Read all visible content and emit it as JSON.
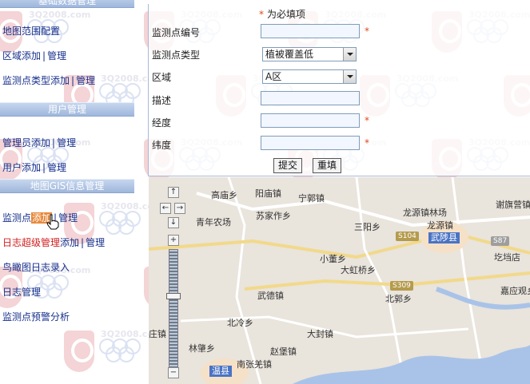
{
  "sidebar": {
    "sections": [
      {
        "header": "基础数据管理",
        "items": [
          {
            "parts": [
              {
                "text": "地图范围配置",
                "style": "navy"
              }
            ]
          },
          {
            "parts": [
              {
                "text": "区域",
                "style": "navy"
              },
              {
                "text": "添加",
                "style": "navy"
              },
              {
                "text": "|",
                "style": "sep"
              },
              {
                "text": "管理",
                "style": "navy"
              }
            ]
          },
          {
            "parts": [
              {
                "text": "监测点类型",
                "style": "navy"
              },
              {
                "text": "添加",
                "style": "navy"
              },
              {
                "text": "|",
                "style": "sep"
              },
              {
                "text": "管理",
                "style": "navy"
              }
            ]
          }
        ]
      },
      {
        "header": "用户管理",
        "items": [
          {
            "parts": [
              {
                "text": "管理员",
                "style": "navy"
              },
              {
                "text": "添加",
                "style": "navy"
              },
              {
                "text": "|",
                "style": "sep"
              },
              {
                "text": "管理",
                "style": "navy"
              }
            ]
          },
          {
            "parts": [
              {
                "text": "用户",
                "style": "navy"
              },
              {
                "text": "添加",
                "style": "navy"
              },
              {
                "text": "|",
                "style": "sep"
              },
              {
                "text": "管理",
                "style": "navy"
              }
            ]
          }
        ]
      },
      {
        "header": "地图GIS信息管理",
        "items": [
          {
            "parts": [
              {
                "text": "监测点",
                "style": "navy"
              },
              {
                "text": "添加",
                "style": "hl"
              },
              {
                "text": "|",
                "style": "sep"
              },
              {
                "text": "管理",
                "style": "navy"
              }
            ]
          },
          {
            "parts": [
              {
                "text": "日志超级管理",
                "style": "red"
              },
              {
                "text": "添加",
                "style": "navy"
              },
              {
                "text": "|",
                "style": "sep"
              },
              {
                "text": "管理",
                "style": "navy"
              }
            ]
          },
          {
            "parts": [
              {
                "text": "鸟瞰图日志录入",
                "style": "navy"
              }
            ]
          },
          {
            "parts": [
              {
                "text": "日志管理",
                "style": "navy"
              }
            ]
          },
          {
            "parts": [
              {
                "text": "监测点预警分析",
                "style": "navy"
              }
            ]
          }
        ]
      }
    ]
  },
  "form": {
    "required_note": "为必填项",
    "required_star": "*",
    "fields": {
      "code": {
        "label": "监测点编号",
        "value": ""
      },
      "type": {
        "label": "监测点类型",
        "selected": "植被覆盖低"
      },
      "region": {
        "label": "区域",
        "selected": "A区"
      },
      "description": {
        "label": "描述",
        "value": ""
      },
      "longitude": {
        "label": "经度",
        "value": ""
      },
      "latitude": {
        "label": "纬度",
        "value": ""
      }
    },
    "submit_label": "提交",
    "reset_label": "重填"
  },
  "map": {
    "places": [
      "高庙乡",
      "阳庙镇",
      "宁郭镇",
      "谢旗营镇",
      "青年农场",
      "苏家作乡",
      "龙源镇林场",
      "龙源镇",
      "三阳乡",
      "小董乡",
      "大虹桥乡",
      "圪垱店",
      "北郭乡",
      "嘉应观乡",
      "武德镇",
      "北冷乡",
      "大封镇",
      "林肇乡",
      "赵堡镇",
      "南张羌镇",
      "庄镇"
    ],
    "city": "武陟县",
    "city2": "温县",
    "routes": [
      "S104",
      "S309",
      "S87"
    ],
    "zoom_in": "+",
    "zoom_out": "−",
    "pan_up": "↑",
    "pan_down": "↓",
    "pan_left": "←",
    "pan_right": "→"
  },
  "watermark": {
    "text": "3Q2008.com"
  },
  "colors": {
    "sidebar_header": "#9fb7dc",
    "link": "#17308c",
    "highlight": "#e8883a",
    "required": "#e04a1a",
    "map_water": "#a9c3e8",
    "map_land": "#e9e4dc"
  }
}
